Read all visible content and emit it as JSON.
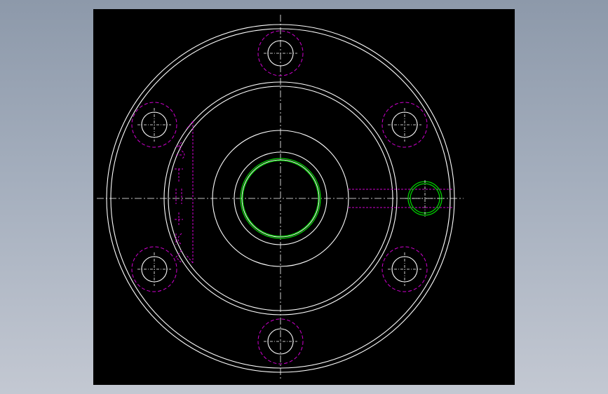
{
  "drawing": {
    "colors": {
      "canvas_background": "#000000",
      "outline": "#ffffff",
      "hidden_threads": "#d000d0",
      "highlight": "#00d000",
      "window_background": "#9aa4b3"
    },
    "bolt_hole_count": 6,
    "side_port_count": 1,
    "dimension_label": ""
  }
}
